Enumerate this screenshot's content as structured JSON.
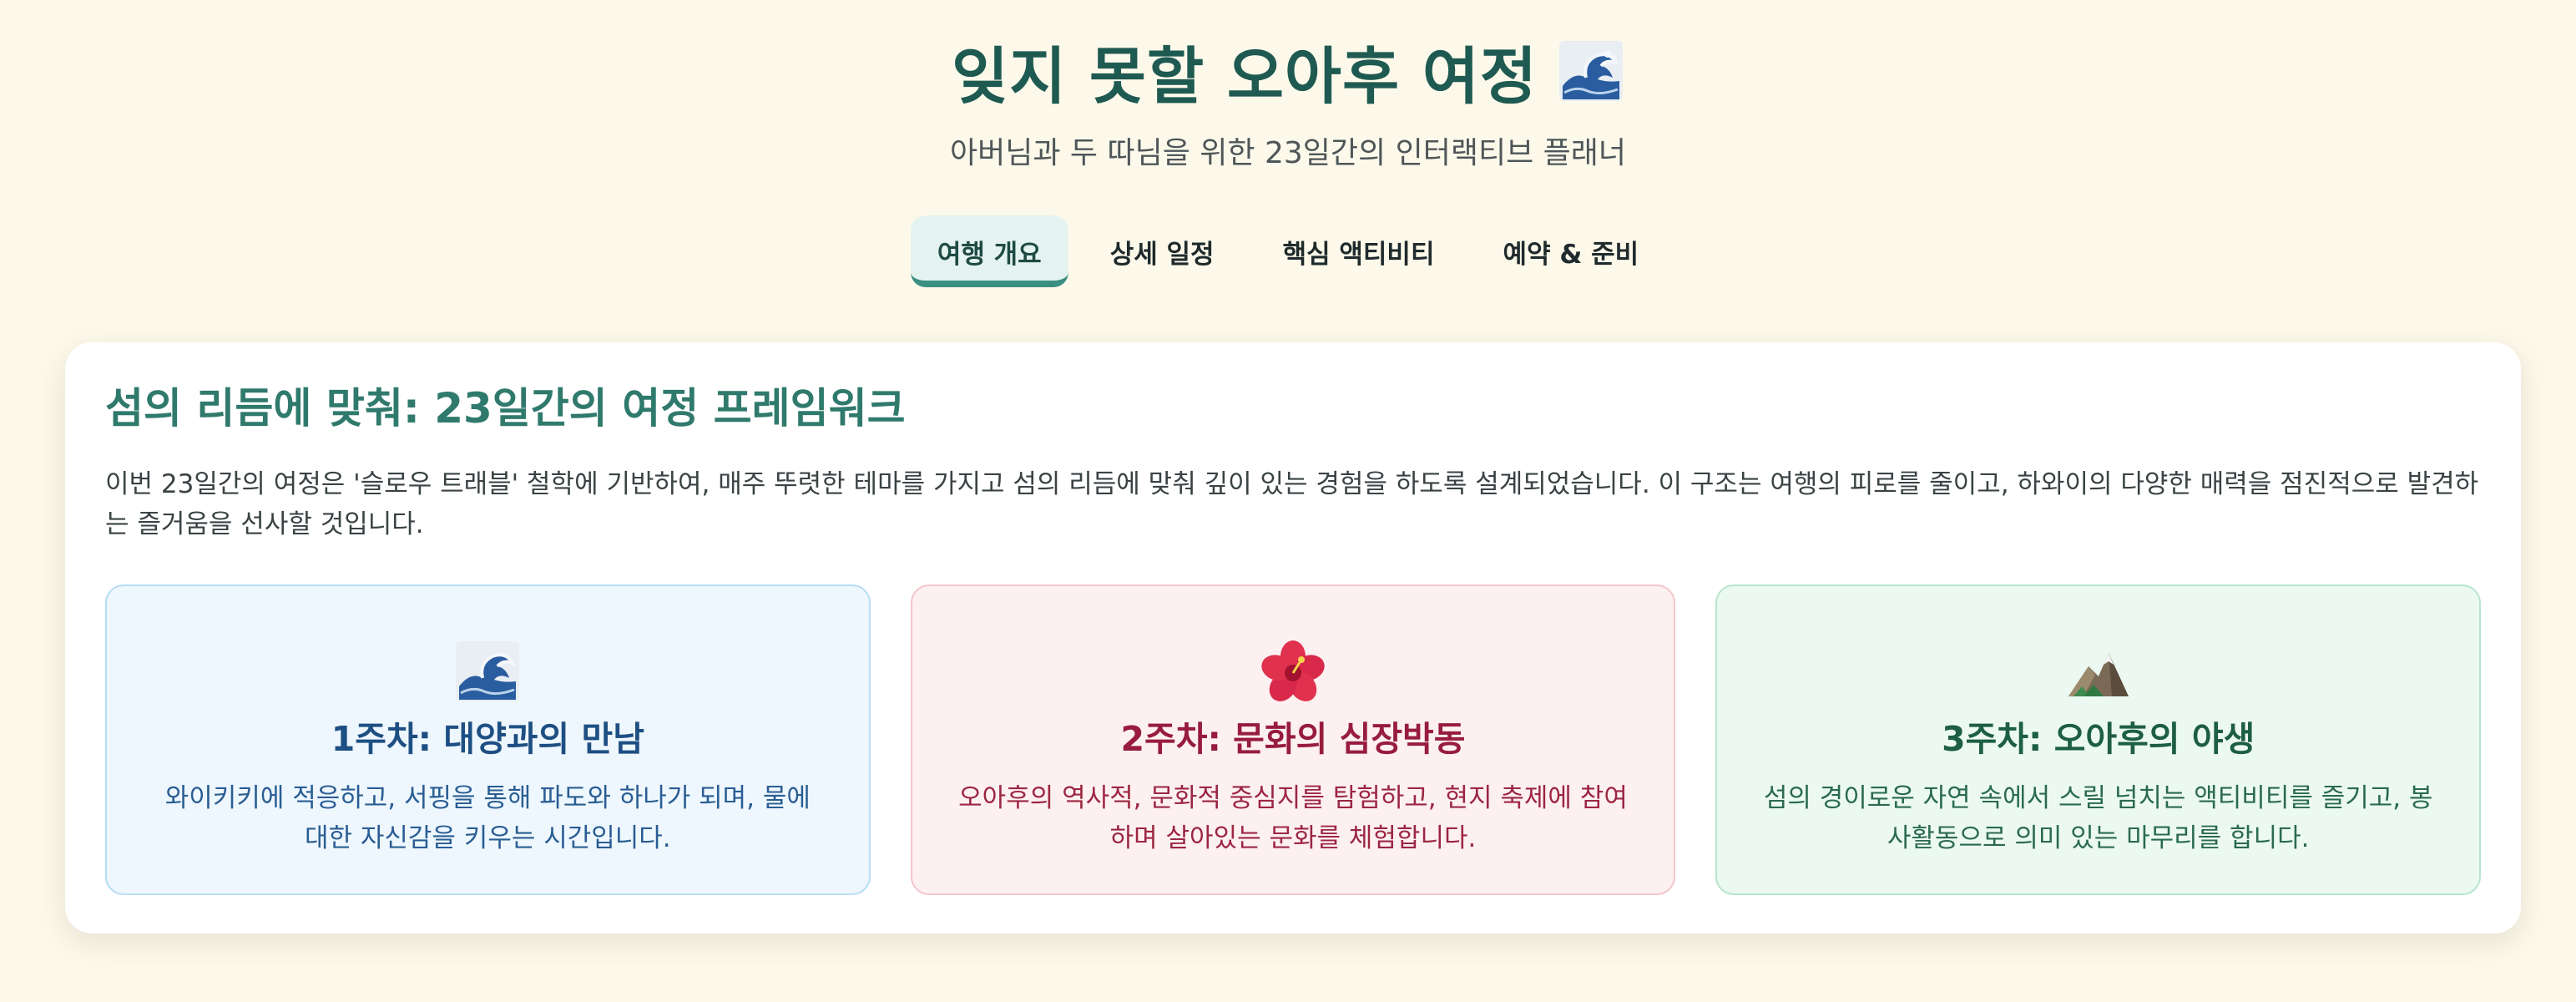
{
  "header": {
    "title": "잊지 못할 오아후 여정",
    "title_emoji": "wave-icon",
    "subtitle": "아버님과 두 따님을 위한 23일간의 인터랙티브 플래너"
  },
  "nav": {
    "tabs": [
      {
        "label": "여행 개요",
        "active": true
      },
      {
        "label": "상세 일정",
        "active": false
      },
      {
        "label": "핵심 액티비티",
        "active": false
      },
      {
        "label": "예약 & 준비",
        "active": false
      }
    ]
  },
  "overview": {
    "heading": "섬의 리듬에 맞춰: 23일간의 여정 프레임워크",
    "description": "이번 23일간의 여정은 '슬로우 트래블' 철학에 기반하여, 매주 뚜렷한 테마를 가지고 섬의 리듬에 맞춰 깊이 있는 경험을 하도록 설계되었습니다. 이 구조는 여행의 피로를 줄이고, 하와이의 다양한 매력을 점진적으로 발견하는 즐거움을 선사할 것입니다.",
    "weeks": [
      {
        "icon": "wave-icon",
        "title": "1주차: 대양과의 만남",
        "text": "와이키키에 적응하고, 서핑을 통해 파도와 하나가 되며, 물에 대한 자신감을 키우는 시간입니다.",
        "accent": "#1e4f83"
      },
      {
        "icon": "hibiscus-icon",
        "title": "2주차: 문화의 심장박동",
        "text": "오아후의 역사적, 문화적 중심지를 탐험하고, 현지 축제에 참여하며 살아있는 문화를 체험합니다.",
        "accent": "#971c3e"
      },
      {
        "icon": "mountain-icon",
        "title": "3주차: 오아후의 야생",
        "text": "섬의 경이로운 자연 속에서 스릴 넘치는 액티비티를 즐기고, 봉사활동으로 의미 있는 마무리를 합니다.",
        "accent": "#1d5e44"
      }
    ]
  }
}
